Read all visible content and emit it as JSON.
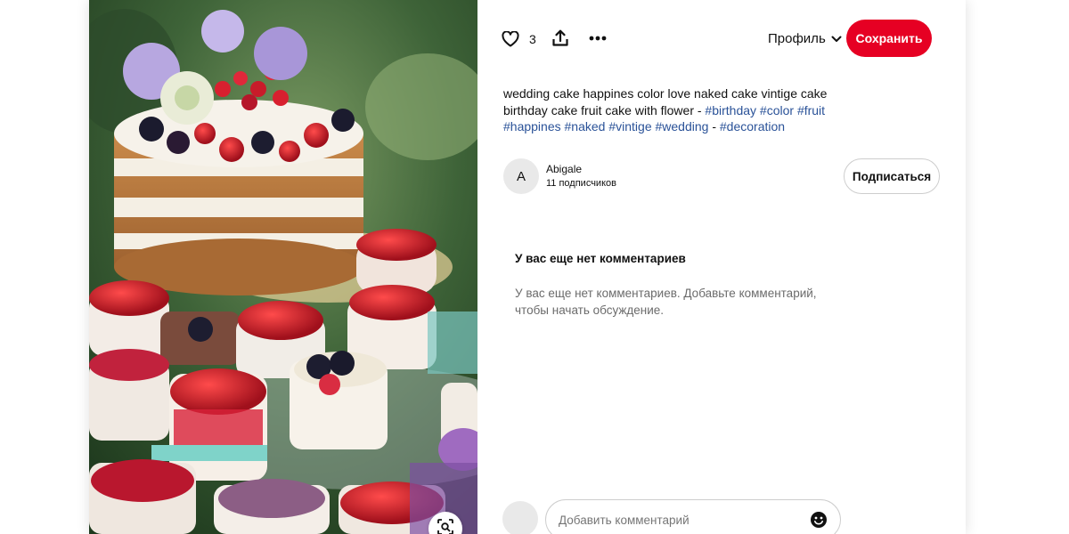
{
  "toolbar": {
    "like_count": "3",
    "profile_label": "Профиль",
    "save_label": "Сохранить",
    "accent_color": "#e60023"
  },
  "pin": {
    "description_text": "wedding cake happines color love naked cake vintige cake birthday cake fruit cake with flower - ",
    "tags": [
      "#birthday",
      "#color",
      "#fruit",
      "#happines",
      "#naked",
      "#vintige",
      "#wedding",
      "#decoration"
    ],
    "tag_separator": "-",
    "tag_color": "#2a5298"
  },
  "author": {
    "initial": "A",
    "name": "Abigale",
    "followers": "11 подписчиков",
    "follow_label": "Подписаться"
  },
  "comments": {
    "title": "У вас еще нет комментариев",
    "empty_text": "У вас еще нет комментариев. Добавьте комментарий, чтобы начать обсуждение.",
    "input_placeholder": "Добавить комментарий"
  },
  "icons": {
    "like": "heart-icon",
    "share": "share-icon",
    "more": "more-icon",
    "profile": "chevron-down-icon",
    "emoji": "emoji-icon",
    "visual_search": "visual-search-icon"
  }
}
